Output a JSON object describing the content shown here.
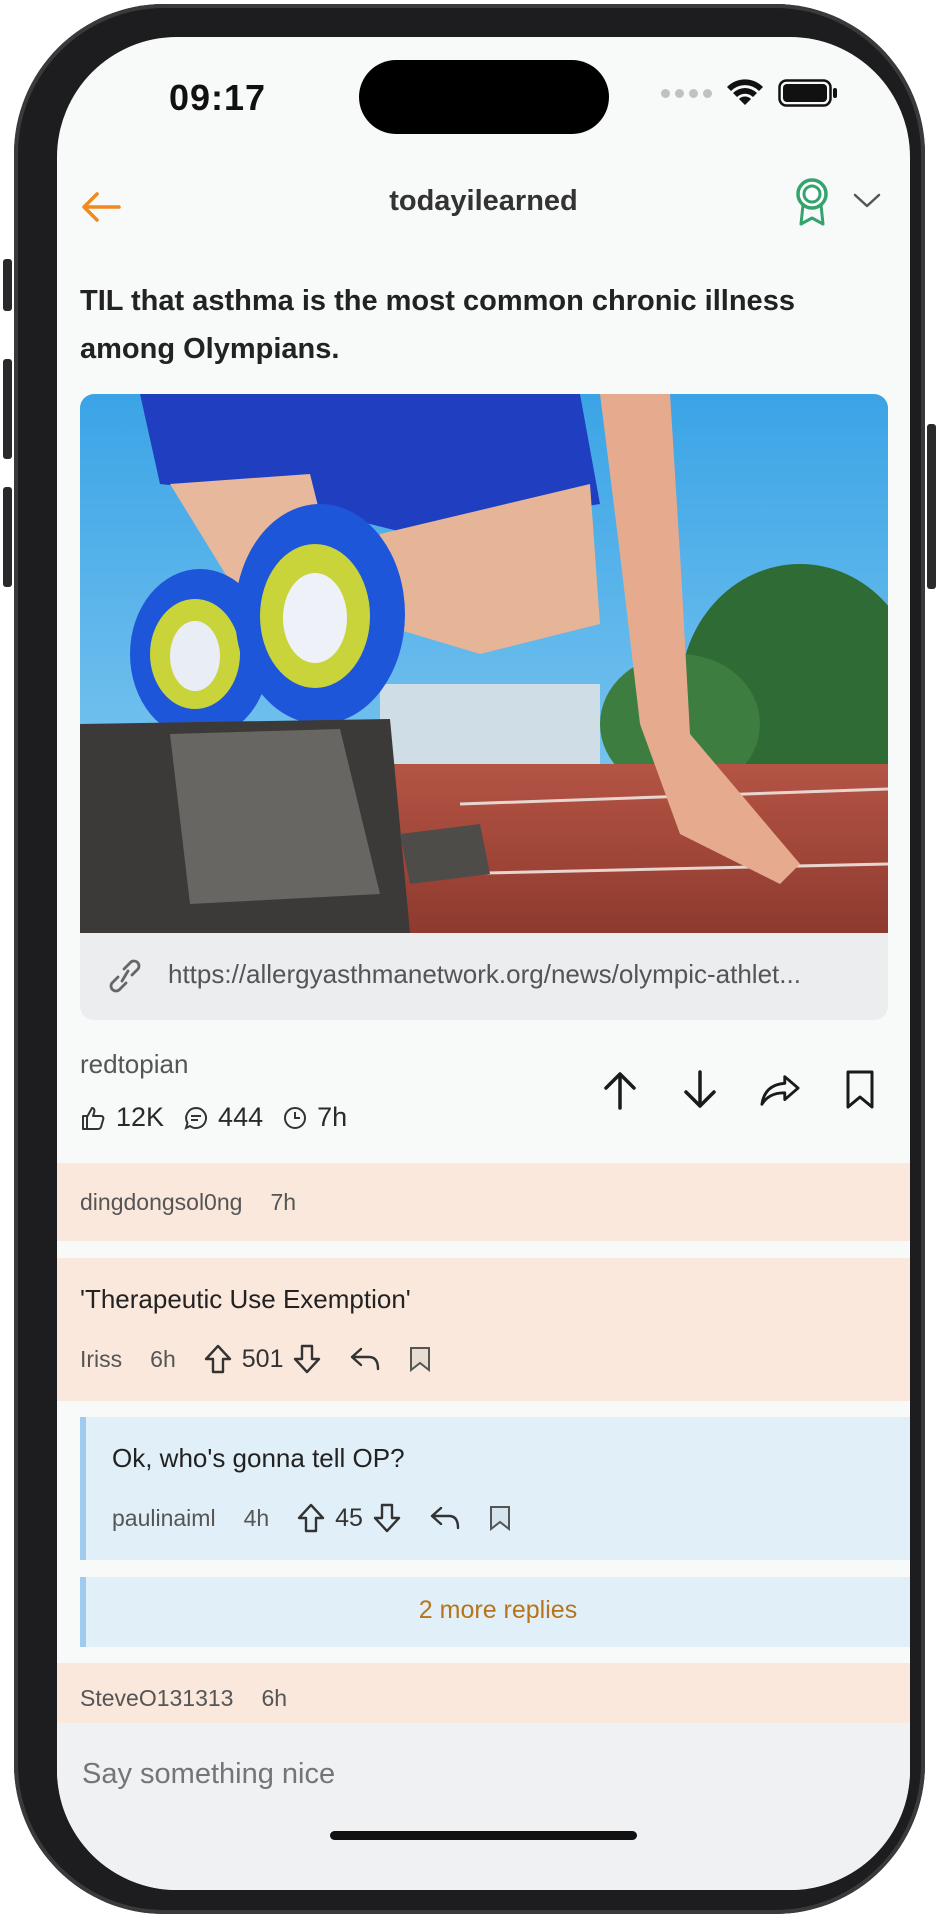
{
  "status": {
    "time": "09:17"
  },
  "header": {
    "subreddit": "todayilearned",
    "colors": {
      "accent": "#f08a1c",
      "award": "#35a36c"
    }
  },
  "post": {
    "title": "TIL that asthma is the most common chronic illness among Olympians.",
    "link_url": "https://allergyasthmanetwork.org/news/olympic-athletes-asthma/",
    "link_display": "https://allergyasthmanetwork.org/news/olympic-athlet...",
    "author": "redtopian",
    "likes": "12K",
    "comments": "444",
    "age": "7h"
  },
  "comments": {
    "collapsed": {
      "user": "dingdongsol0ng",
      "age": "7h"
    },
    "main": {
      "text": "'Therapeutic Use Exemption'",
      "user": "Iriss",
      "age": "6h",
      "score": "501"
    },
    "reply": {
      "text": "Ok, who's gonna tell OP?",
      "user": "paulinaiml",
      "age": "4h",
      "score": "45"
    },
    "more_replies": "2 more replies",
    "next": {
      "user": "SteveO131313",
      "age": "6h"
    }
  },
  "composer": {
    "placeholder": "Say something nice"
  }
}
